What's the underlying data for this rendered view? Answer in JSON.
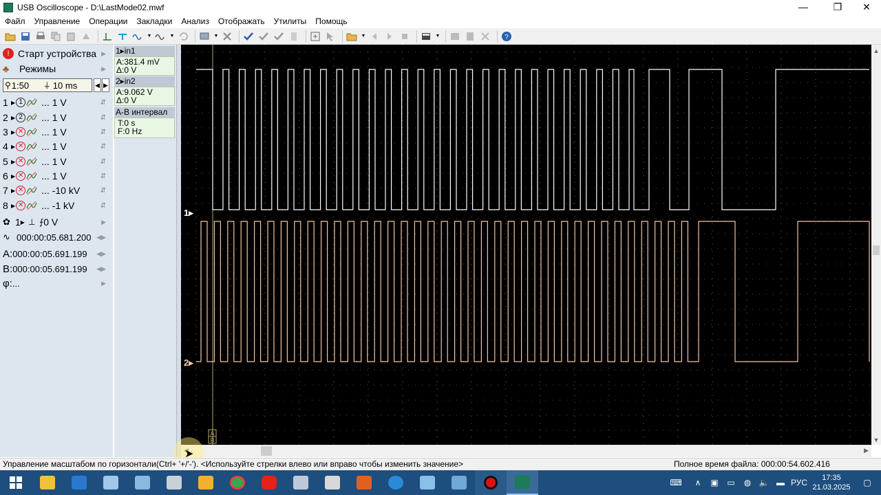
{
  "window": {
    "title": "USB Oscilloscope - D:\\LastMode02.mwf",
    "minimize": "—",
    "restore": "❐",
    "close": "✕"
  },
  "menu": [
    "Файл",
    "Управление",
    "Операции",
    "Закладки",
    "Анализ",
    "Отображать",
    "Утилиты",
    "Помощь"
  ],
  "left": {
    "start_label": "Старт устройства",
    "modes_label": "Режимы",
    "zoom": "1:50",
    "timebase": "10 ms",
    "channels": [
      {
        "num": "1",
        "icon": "1",
        "val": "... 1 V",
        "active": true
      },
      {
        "num": "2",
        "icon": "2",
        "val": "... 1 V",
        "active": true
      },
      {
        "num": "3",
        "icon": "",
        "val": "... 1 V",
        "active": false
      },
      {
        "num": "4",
        "icon": "",
        "val": "... 1 V",
        "active": false
      },
      {
        "num": "5",
        "icon": "",
        "val": "... 1 V",
        "active": false
      },
      {
        "num": "6",
        "icon": "",
        "val": "... 1 V",
        "active": false
      },
      {
        "num": "7",
        "icon": "",
        "val": "... -10 kV",
        "active": false
      },
      {
        "num": "8",
        "icon": "",
        "val": "... -1 kV",
        "active": false
      }
    ],
    "trigger_channel": "1",
    "trigger_level": "0 V",
    "delay": "000:00:05.681.200",
    "marker_a_label": "A:",
    "marker_a": "000:00:05.691.199",
    "marker_b_label": "B:",
    "marker_b": "000:00:05.691.199",
    "phi_label": "φ:",
    "phi": "..."
  },
  "measure": {
    "in1_head": "1▸in1",
    "in1_a": "A:381.4 mV",
    "in1_d": "Δ:0 V",
    "in2_head": "2▸in2",
    "in2_a": "A:9.062 V",
    "in2_d": "Δ:0 V",
    "ab_head": "A-B интервал",
    "ab_t": "T:0 s",
    "ab_f": "F:0 Hz"
  },
  "scope": {
    "ch1_label": "1▸",
    "ch2_label": "2▸",
    "ch1_color": "#ffffff",
    "ch2_color": "#f3c9a6",
    "cursor_a": "A",
    "cursor_b": "B"
  },
  "status": {
    "left": "Управление масштабом по горизонтали(Ctrl+ '+/'-'). <Используйте стрелки влево или вправо чтобы изменить значение>",
    "right": "Полное время файла: 000:00:54.602.416"
  },
  "taskbar": {
    "time": "17:35",
    "date": "21.03.2025",
    "lang": "РУС"
  }
}
